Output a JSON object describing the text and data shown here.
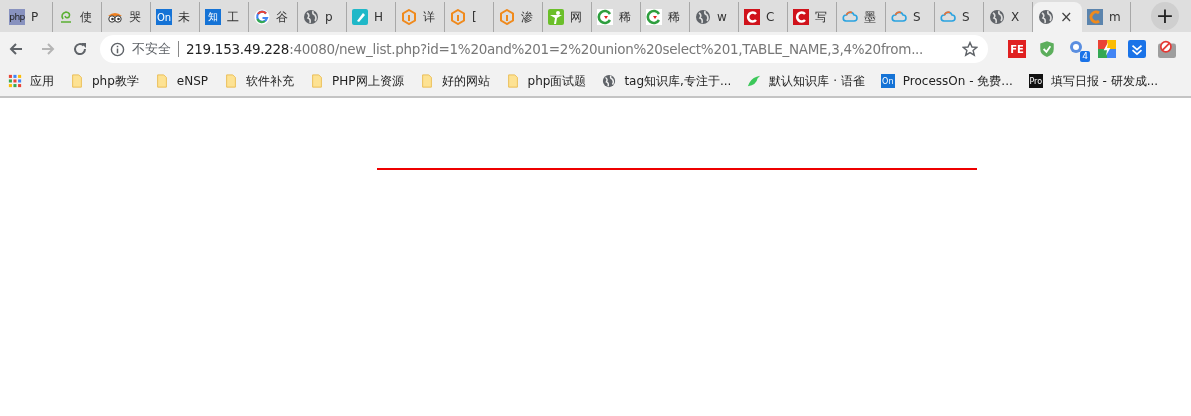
{
  "tabs": [
    {
      "kind": "php",
      "icon_text": "php",
      "title": "P",
      "selected": false
    },
    {
      "kind": "swirl",
      "title": "使",
      "selected": false
    },
    {
      "kind": "eyes",
      "title": "哭",
      "selected": false
    },
    {
      "kind": "badge",
      "icon_text": "On",
      "title": "未",
      "selected": false
    },
    {
      "kind": "badge",
      "icon_text": "知",
      "title": "工",
      "selected": false
    },
    {
      "kind": "google",
      "title": "谷",
      "selected": false
    },
    {
      "kind": "globe",
      "title": "p",
      "selected": false
    },
    {
      "kind": "pen",
      "title": "H",
      "selected": false
    },
    {
      "kind": "hex",
      "title": "详",
      "selected": false
    },
    {
      "kind": "hex",
      "title": "[",
      "selected": false
    },
    {
      "kind": "hex",
      "title": "渗",
      "selected": false
    },
    {
      "kind": "person",
      "title": "网",
      "selected": false
    },
    {
      "kind": "ring",
      "title": "稀",
      "selected": false
    },
    {
      "kind": "ring",
      "title": "稀",
      "selected": false
    },
    {
      "kind": "globe",
      "title": "w",
      "selected": false
    },
    {
      "kind": "redc",
      "title": "C",
      "selected": false
    },
    {
      "kind": "redc",
      "title": "写",
      "selected": false
    },
    {
      "kind": "cloud",
      "title": "墨",
      "selected": false
    },
    {
      "kind": "cloud",
      "title": "S",
      "selected": false
    },
    {
      "kind": "cloud",
      "title": "S",
      "selected": false
    },
    {
      "kind": "globe",
      "title": "X",
      "selected": false
    },
    {
      "kind": "globe",
      "close": "×",
      "selected": true
    },
    {
      "kind": "orangec",
      "title": "m",
      "selected": false
    }
  ],
  "new_tab": "+",
  "address_bar": {
    "security": "不安全",
    "host": "219.153.49.228",
    "rest": ":40080/new_list.php?id=1%20and%201=2%20union%20select%201,TABLE_NAME,3,4%20from..."
  },
  "extensions": [
    {
      "kind": "fe",
      "icon_text": "FE"
    },
    {
      "kind": "shield"
    },
    {
      "kind": "bulb",
      "icon_text": "4"
    },
    {
      "kind": "bolt"
    },
    {
      "kind": "download"
    },
    {
      "kind": "blocked"
    }
  ],
  "bookmarks": [
    {
      "kind": "apps",
      "label": "应用"
    },
    {
      "kind": "folder",
      "label": "php教学"
    },
    {
      "kind": "folder",
      "label": "eNSP"
    },
    {
      "kind": "folder",
      "label": "软件补充"
    },
    {
      "kind": "folder",
      "label": "PHP网上资源"
    },
    {
      "kind": "folder",
      "label": "好的网站"
    },
    {
      "kind": "folder",
      "label": "php面试题"
    },
    {
      "kind": "globe",
      "label": "tag知识库,专注于..."
    },
    {
      "kind": "bird",
      "label": "默认知识库 · 语雀"
    },
    {
      "kind": "badge",
      "icon_text": "On",
      "label": "ProcessOn - 免费..."
    },
    {
      "kind": "dark",
      "icon_text": "Pro",
      "label": "填写日报 - 研发成..."
    }
  ]
}
